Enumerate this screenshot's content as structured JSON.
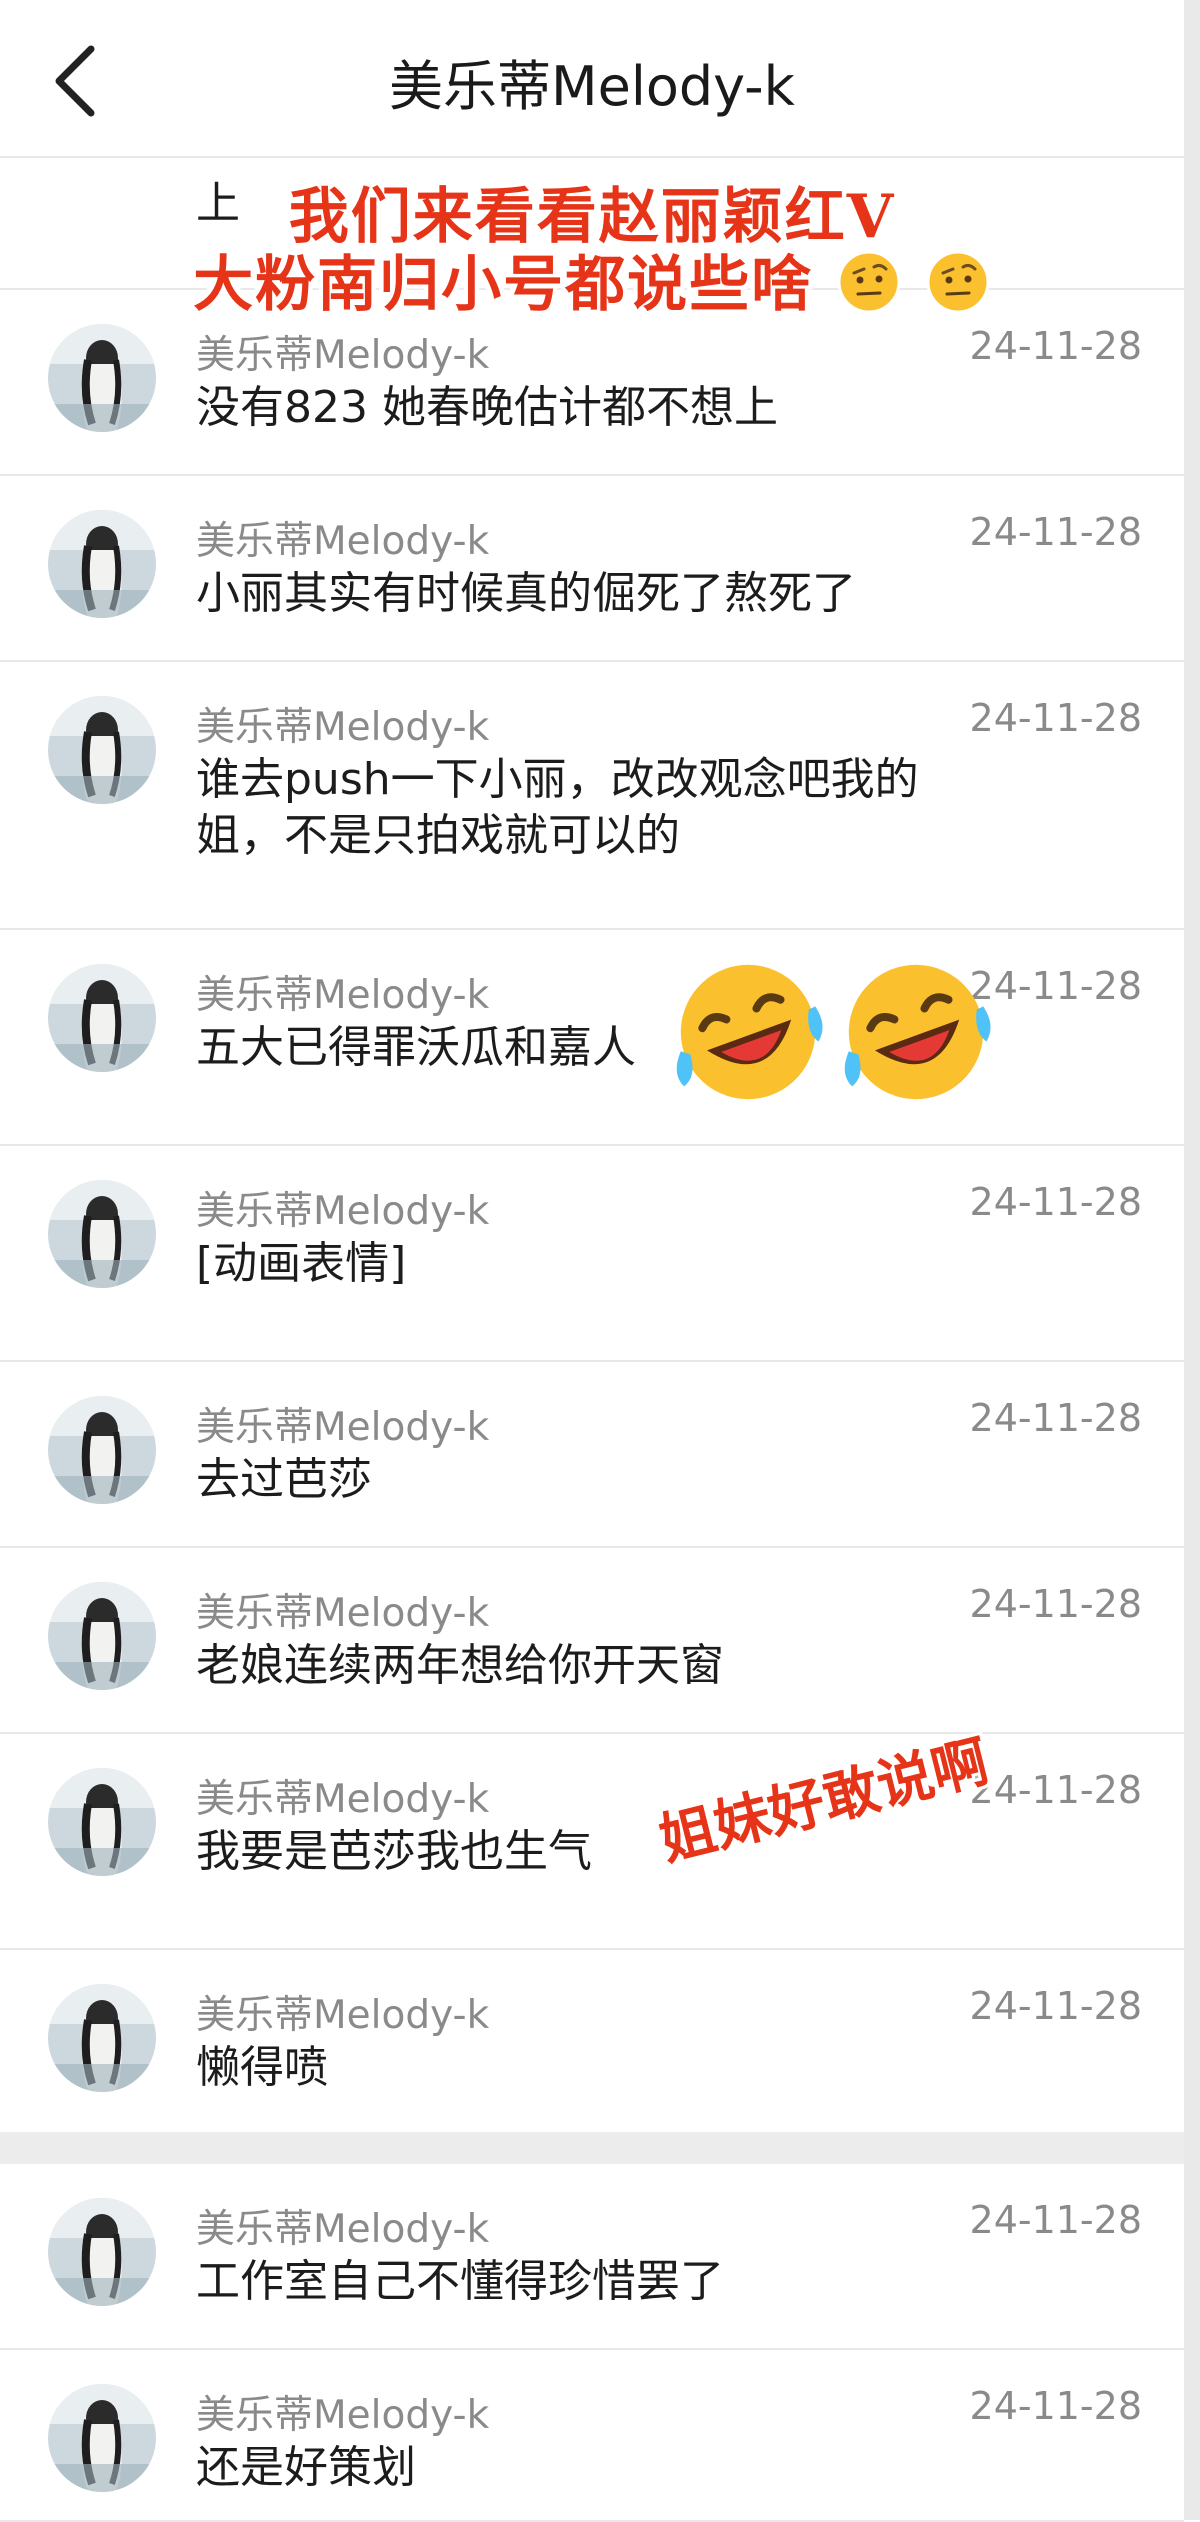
{
  "header": {
    "title": "美乐蒂Melody-k"
  },
  "overlay": {
    "line1": "我们来看看赵丽颖红V",
    "line2": "大粉南归小号都说些啥",
    "caption": "姐妹好敢说啊"
  },
  "partial_text": "上",
  "messages": [
    {
      "name": "美乐蒂Melody-k",
      "time": "24-11-28",
      "text": "没有823 她春晚估计都不想上"
    },
    {
      "name": "美乐蒂Melody-k",
      "time": "24-11-28",
      "text": "小丽其实有时候真的倔死了熬死了"
    },
    {
      "name": "美乐蒂Melody-k",
      "time": "24-11-28",
      "text": "谁去push一下小丽，改改观念吧我的姐，不是只拍戏就可以的"
    },
    {
      "name": "美乐蒂Melody-k",
      "time": "24-11-28",
      "text": "五大已得罪沃瓜和嘉人"
    },
    {
      "name": "美乐蒂Melody-k",
      "time": "24-11-28",
      "text": "[动画表情]"
    },
    {
      "name": "美乐蒂Melody-k",
      "time": "24-11-28",
      "text": "去过芭莎"
    },
    {
      "name": "美乐蒂Melody-k",
      "time": "24-11-28",
      "text": "老娘连续两年想给你开天窗"
    },
    {
      "name": "美乐蒂Melody-k",
      "time": "24-11-28",
      "text": "我要是芭莎我也生气"
    },
    {
      "name": "美乐蒂Melody-k",
      "time": "24-11-28",
      "text": "懒得喷"
    },
    {
      "name": "美乐蒂Melody-k",
      "time": "24-11-28",
      "text": "工作室自己不懂得珍惜罢了"
    },
    {
      "name": "美乐蒂Melody-k",
      "time": "24-11-28",
      "text": "还是好策划"
    }
  ],
  "icons": {
    "back": "chevron-left-icon",
    "emoji_laugh": "rolling-laughing-emoji",
    "emoji_raised": "raised-eyebrow-emoji"
  }
}
